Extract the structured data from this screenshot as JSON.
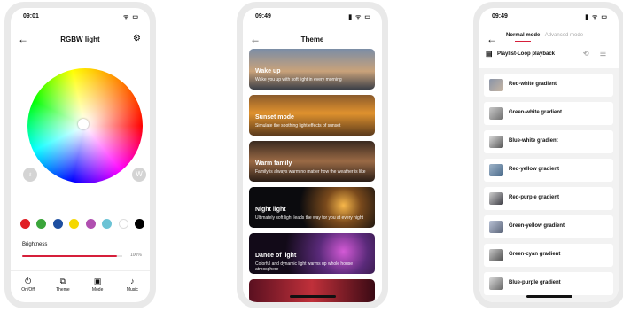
{
  "phone1": {
    "time": "09:01",
    "status_icons": "ᯤ ▭",
    "title": "RGBW light",
    "back_icon": "arrow-left-icon",
    "settings_icon": "gear-icon",
    "left_round_label": "♁",
    "right_round_label": "W",
    "swatches": [
      "#e01f24",
      "#3aa53a",
      "#1d4ea0",
      "#f5d800",
      "#b04fb0",
      "#6cc3d5",
      "#ffffff",
      "#000000"
    ],
    "brightness_label": "Brightness",
    "brightness_value": "100%",
    "brightness_level": 1.0,
    "tabs": [
      {
        "label": "On/Off",
        "icon": "⏻"
      },
      {
        "label": "Theme",
        "icon": "⧉"
      },
      {
        "label": "Mode",
        "icon": "▣"
      },
      {
        "label": "Music",
        "icon": "♪"
      }
    ]
  },
  "phone2": {
    "time": "09:49",
    "status_icons": "▮ ᯤ ▭",
    "title": "Theme",
    "cards": [
      {
        "title": "Wake up",
        "desc": "Wake you up with soft light in every morning"
      },
      {
        "title": "Sunset mode",
        "desc": "Simulate the soothing light effects of sunset"
      },
      {
        "title": "Warm family",
        "desc": "Family is always warm no matter how the weather is like"
      },
      {
        "title": "Night light",
        "desc": "Ultimately soft light leads the way for you at every night"
      },
      {
        "title": "Dance of light",
        "desc": "Colorful and dynamic light warms up whole house atmosphere"
      }
    ]
  },
  "phone3": {
    "time": "09:49",
    "status_icons": "▮ ᯤ ▭",
    "mode_active": "Normal mode",
    "mode_inactive": "Advanced mode",
    "playlist_label": "Playlist-Loop playback",
    "playlist_controls": "⟲ ☰",
    "gradients": [
      "Red-white gradient",
      "Green-white gradient",
      "Blue-white gradient",
      "Red-yellow gradient",
      "Red-purple gradient",
      "Green-yellow gradient",
      "Green-cyan gradient",
      "Blue-purple gradient"
    ]
  }
}
